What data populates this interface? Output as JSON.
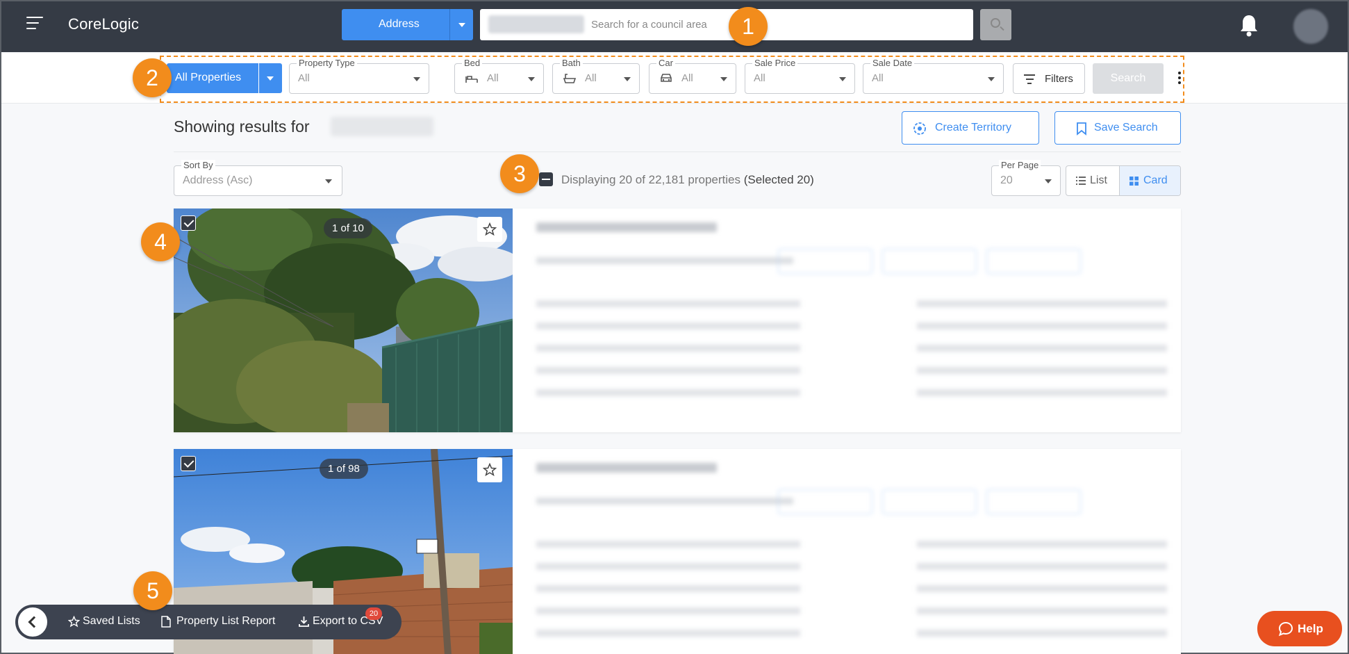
{
  "header": {
    "logo": "CoreLogic",
    "search_mode": "Address",
    "search_placeholder": "Search for a council area"
  },
  "filters": {
    "property_scope": "All Properties",
    "property_type": {
      "label": "Property Type",
      "value": "All"
    },
    "bed": {
      "label": "Bed",
      "value": "All"
    },
    "bath": {
      "label": "Bath",
      "value": "All"
    },
    "car": {
      "label": "Car",
      "value": "All"
    },
    "sale_price": {
      "label": "Sale Price",
      "value": "All"
    },
    "sale_date": {
      "label": "Sale Date",
      "value": "All"
    },
    "filters_label": "Filters",
    "search_label": "Search"
  },
  "results": {
    "showing_label": "Showing results for",
    "create_territory": "Create Territory",
    "save_search": "Save Search",
    "sort_by": {
      "label": "Sort By",
      "value": "Address (Asc)"
    },
    "displaying": "Displaying 20 of 22,181 properties",
    "selected": "(Selected 20)",
    "per_page": {
      "label": "Per Page",
      "value": "20"
    },
    "view_list": "List",
    "view_card": "Card"
  },
  "cards": [
    {
      "photo_counter": "1 of 10"
    },
    {
      "photo_counter": "1 of 98"
    }
  ],
  "steps": [
    "1",
    "2",
    "3",
    "4",
    "5"
  ],
  "bottom_bar": {
    "saved_lists": "Saved Lists",
    "property_list_report": "Property List Report",
    "export_csv": "Export to CSV",
    "export_badge": "20"
  },
  "help": "Help",
  "colors": {
    "topbar": "#353b45",
    "accent_blue": "#3f8ef0",
    "step_orange": "#f28c1c",
    "help_orange": "#e8501f"
  }
}
